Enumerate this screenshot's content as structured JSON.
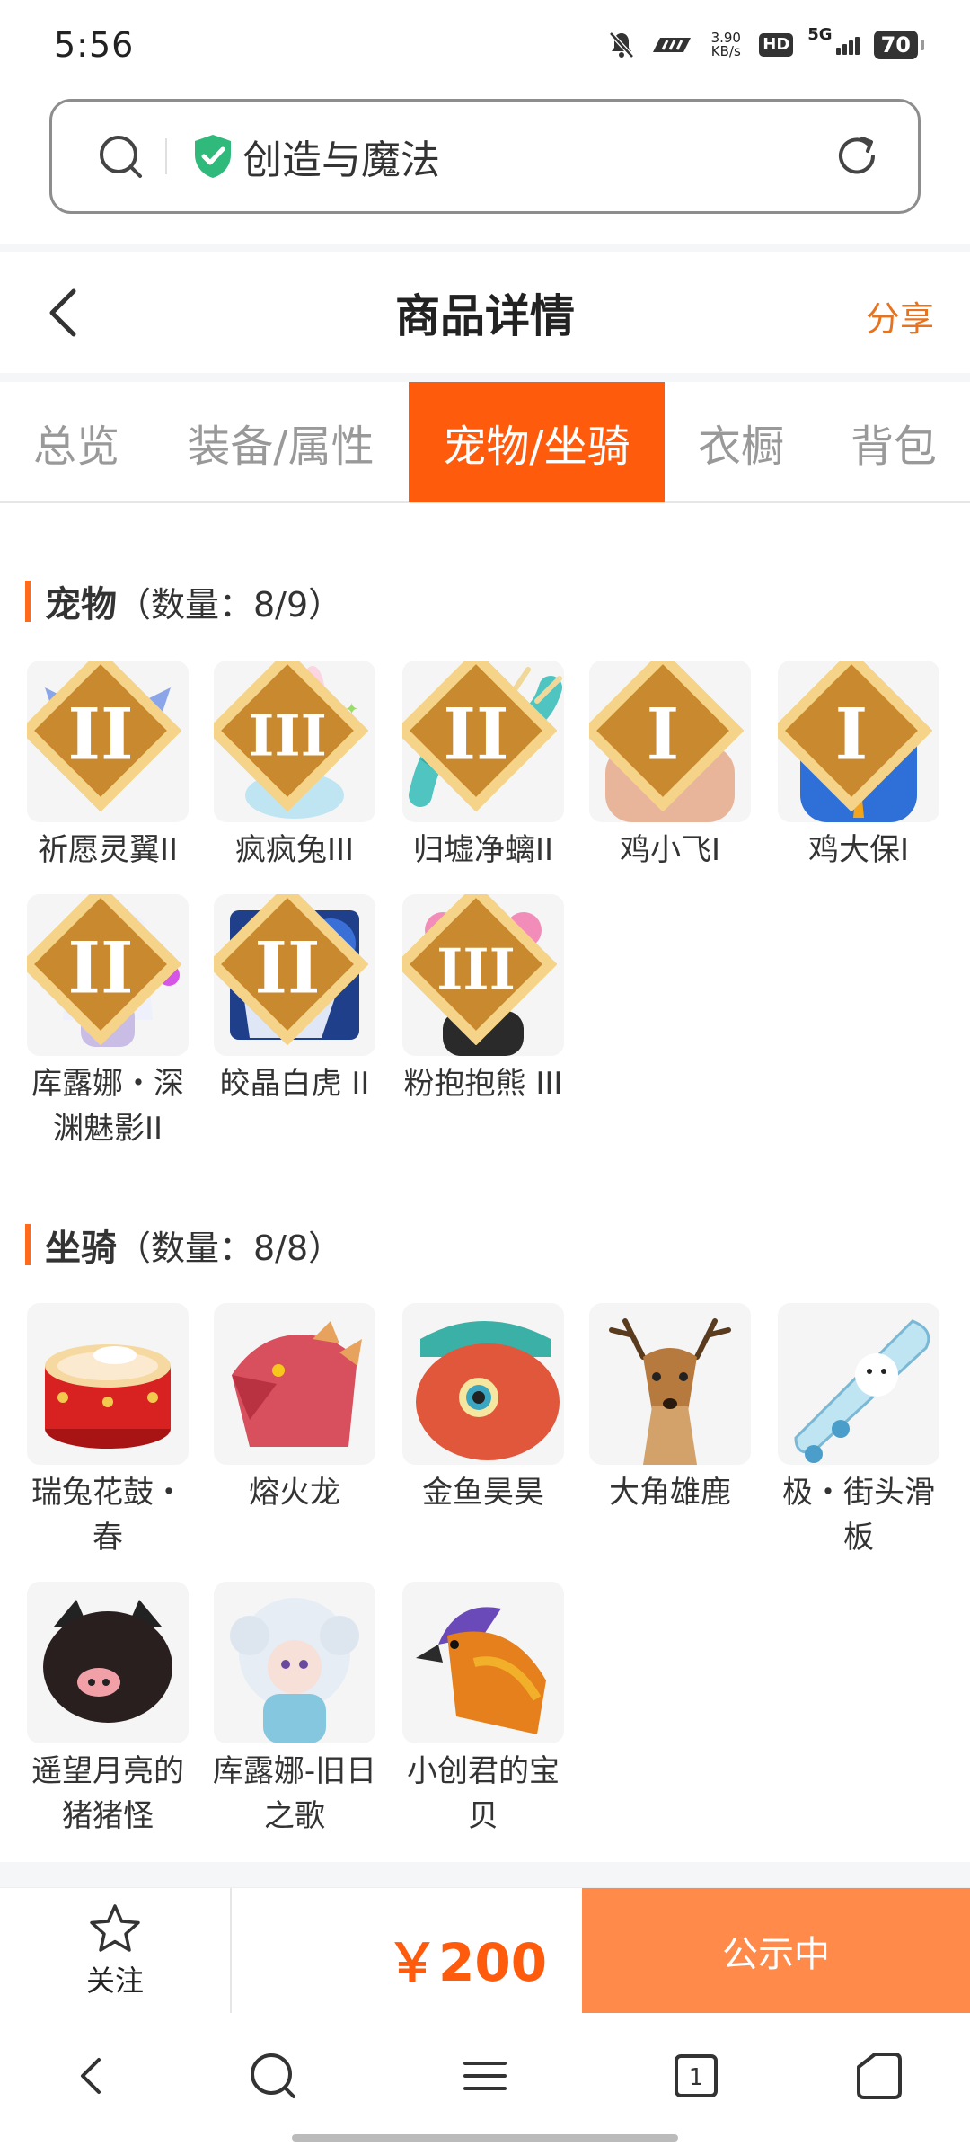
{
  "status_bar": {
    "time": "5:56",
    "speed": "3.90",
    "speed_unit": "KB/s",
    "hd": "HD",
    "network": "5G",
    "battery": "70"
  },
  "url_bar": {
    "text": "创造与魔法"
  },
  "header": {
    "title": "商品详情",
    "share": "分享"
  },
  "tabs": [
    {
      "label": "总览"
    },
    {
      "label": "装备/属性"
    },
    {
      "label": "宠物/坐骑",
      "active": true
    },
    {
      "label": "衣橱"
    },
    {
      "label": "背包"
    }
  ],
  "pets": {
    "title": "宠物",
    "count": "（数量：8/9）",
    "items": [
      {
        "name": "祈愿灵翼II",
        "badge": "II",
        "icon": "griffin-icon"
      },
      {
        "name": "疯疯兔III",
        "badge": "III",
        "icon": "rabbit-icon"
      },
      {
        "name": "归墟净螭II",
        "badge": "II",
        "icon": "dragon-icon"
      },
      {
        "name": "鸡小飞I",
        "badge": "I",
        "icon": "blue-chick-icon"
      },
      {
        "name": "鸡大保I",
        "badge": "I",
        "icon": "blue-bird-icon"
      },
      {
        "name": "库露娜・深渊魅影II",
        "badge": "II",
        "icon": "spirit-girl-icon"
      },
      {
        "name": "皎晶白虎 II",
        "badge": "II",
        "icon": "tiger-icon"
      },
      {
        "name": "粉抱抱熊 III",
        "badge": "III",
        "icon": "bear-icon"
      }
    ]
  },
  "mounts": {
    "title": "坐骑",
    "count": "（数量：8/8）",
    "items": [
      {
        "name": "瑞兔花鼓・春",
        "icon": "drum-icon"
      },
      {
        "name": "熔火龙",
        "icon": "fire-dragon-icon"
      },
      {
        "name": "金鱼昊昊",
        "icon": "goldfish-icon"
      },
      {
        "name": "大角雄鹿",
        "icon": "deer-icon"
      },
      {
        "name": "极・街头滑板",
        "icon": "skateboard-icon"
      },
      {
        "name": "遥望月亮的猪猪怪",
        "icon": "pig-icon"
      },
      {
        "name": "库露娜-旧日之歌",
        "icon": "doll-icon"
      },
      {
        "name": "小创君的宝贝",
        "icon": "phoenix-icon"
      }
    ]
  },
  "action_bar": {
    "follow": "关注",
    "price": "￥200",
    "status": "公示中"
  },
  "colors": {
    "accent": "#ff5b0d",
    "status_button": "#ff8a4a",
    "share": "#e8731f"
  }
}
